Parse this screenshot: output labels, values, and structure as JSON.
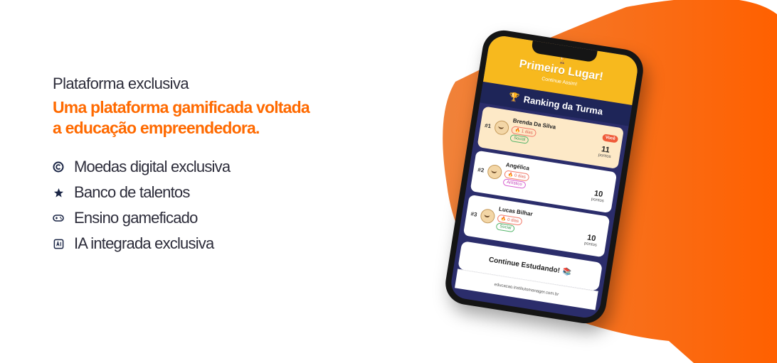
{
  "intro": {
    "eyebrow": "Plataforma exclusiva",
    "headline_line1": "Uma plataforma gamificada voltada",
    "headline_line2": "a educação empreendedora."
  },
  "features": [
    {
      "icon": "copyright-coin-icon",
      "label": "Moedas digital exclusiva"
    },
    {
      "icon": "star-icon",
      "label": "Banco de talentos"
    },
    {
      "icon": "gamepad-icon",
      "label": "Ensino gameficado"
    },
    {
      "icon": "ai-box-icon",
      "label": "IA integrada exclusiva"
    }
  ],
  "phone": {
    "hero_title": "Primeiro Lugar!",
    "hero_subtitle": "Continue Assim!",
    "ranking_title": "Ranking da Turma",
    "ranking": [
      {
        "position": "#1",
        "name": "Brenda Da Silva",
        "days": "1 dias",
        "tag": "Social",
        "badge": "Você",
        "points": "11",
        "points_label": "pontos"
      },
      {
        "position": "#2",
        "name": "Angélica",
        "days": "0 dias",
        "tag": "Artístico",
        "points": "10",
        "points_label": "pontos"
      },
      {
        "position": "#3",
        "name": "Lucas Bilhar",
        "days": "0 dias",
        "tag": "Social",
        "points": "10",
        "points_label": "pontos"
      }
    ],
    "cta": "Continue Estudando!",
    "url": "educacao.institutomanager.com.br"
  },
  "colors": {
    "accent": "#ff6a00",
    "navy": "#1a2545",
    "gold": "#f7b91e"
  }
}
